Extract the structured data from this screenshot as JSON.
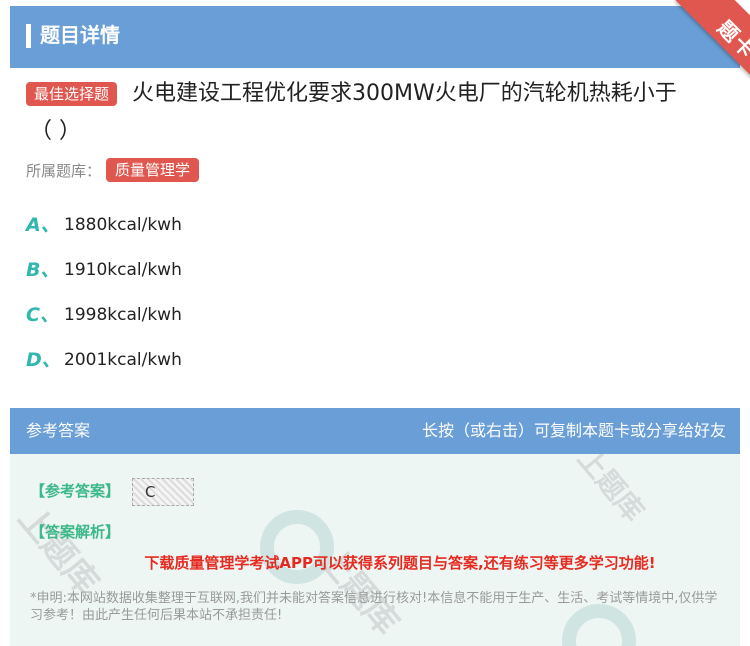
{
  "header": {
    "title": "题目详情",
    "ribbon": "题卡"
  },
  "question": {
    "tag": "最佳选择题",
    "text": "火电建设工程优化要求300MW火电厂的汽轮机热耗小于",
    "paren": "（    ）",
    "library_label": "所属题库：",
    "library_name": "质量管理学"
  },
  "options": [
    {
      "letter": "A、",
      "text": "1880kcal/kwh"
    },
    {
      "letter": "B、",
      "text": "1910kcal/kwh"
    },
    {
      "letter": "C、",
      "text": "1998kcal/kwh"
    },
    {
      "letter": "D、",
      "text": "2001kcal/kwh"
    }
  ],
  "answer": {
    "bar_left": "参考答案",
    "bar_right": "长按（或右击）可复制本题卡或分享给好友",
    "ref_label": "【参考答案】",
    "ref_value": "C",
    "analysis_label": "【答案解析】",
    "promo": "下载质量管理学考试APP可以获得系列题目与答案,还有练习等更多学习功能!",
    "disclaimer": "*申明:本网站数据收集整理于互联网,我们并未能对答案信息进行核对!本信息不能用于生产、生活、考试等情境中,仅供学习参考！由此产生任何后果本站不承担责任!"
  },
  "colors": {
    "header": "#6a9ed6",
    "tag": "#e0574f",
    "option_letter": "#2fb7b0",
    "answer_label": "#3cb88a",
    "promo": "#e52b21"
  }
}
